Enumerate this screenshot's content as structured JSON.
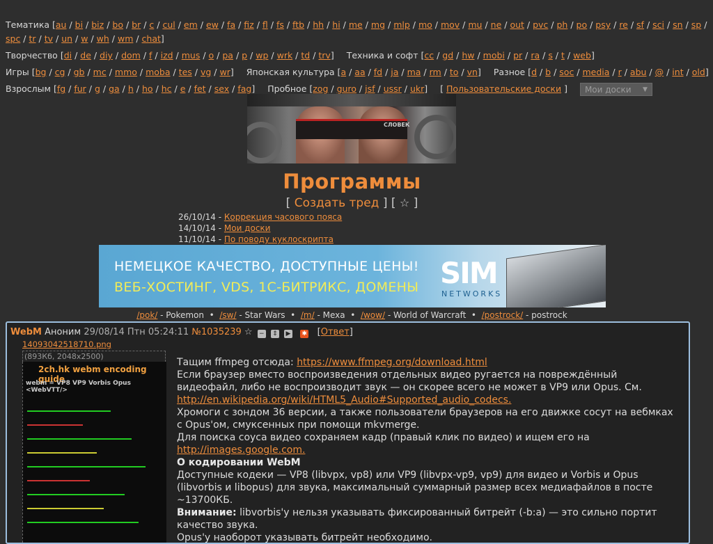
{
  "nav": {
    "row1_label": "Тематика",
    "row1": [
      "au",
      "bi",
      "biz",
      "bo",
      "br",
      "c",
      "cul",
      "em",
      "ew",
      "fa",
      "fiz",
      "fl",
      "fs",
      "ftb",
      "hh",
      "hi",
      "me",
      "mg",
      "mlp",
      "mo",
      "mov",
      "mu",
      "ne",
      "out",
      "pvc",
      "ph",
      "po",
      "psy",
      "re",
      "sf",
      "sci",
      "sn",
      "sp",
      "spc",
      "tr",
      "tv",
      "un",
      "w",
      "wh",
      "wm",
      "chat"
    ],
    "row2_label": "Творчество",
    "row2": [
      "di",
      "de",
      "diy",
      "dom",
      "f",
      "izd",
      "mus",
      "o",
      "pa",
      "p",
      "wp",
      "wrk",
      "td",
      "trv"
    ],
    "row2b_label": "Техника и софт",
    "row2b": [
      "cc",
      "gd",
      "hw",
      "mobi",
      "pr",
      "ra",
      "s",
      "t",
      "web"
    ],
    "row3_label": "Игры",
    "row3": [
      "bg",
      "cg",
      "gb",
      "mc",
      "mmo",
      "moba",
      "tes",
      "vg",
      "wr"
    ],
    "row3b_label": "Японская культура",
    "row3b": [
      "a",
      "aa",
      "fd",
      "ja",
      "ma",
      "rm",
      "to",
      "vn"
    ],
    "row3c_label": "Разное",
    "row3c": [
      "d",
      "b",
      "soc",
      "media",
      "r",
      "abu",
      "@",
      "int",
      "old"
    ],
    "row4_label": "Взрослым",
    "row4": [
      "fg",
      "fur",
      "g",
      "ga",
      "h",
      "ho",
      "hc",
      "e",
      "fet",
      "sex",
      "fag"
    ],
    "row4b_label": "Пробное",
    "row4b": [
      "zog",
      "guro",
      "jsf",
      "ussr",
      "ukr"
    ],
    "user_boards": "Пользовательские доски",
    "my_boards": "Мои доски"
  },
  "logo_text": "СЛОВЕК",
  "board_title": "Программы",
  "create_thread": "Создать тред",
  "news": [
    {
      "date": "26/10/14 -",
      "text": "Коррекция часового пояса"
    },
    {
      "date": "14/10/14 -",
      "text": "Мои доски"
    },
    {
      "date": "11/10/14 -",
      "text": "По поводу куклоскрипта"
    }
  ],
  "banner": {
    "line1": "НЕМЕЦКОЕ КАЧЕСТВО, ДОСТУПНЫЕ ЦЕНЫ!",
    "line2": "ВЕБ-ХОСТИНГ, VDS, 1С-БИТРИКС, ДОМЕНЫ",
    "brand": "SIM",
    "brand_sub": "NETWORKS"
  },
  "boards_line": [
    {
      "code": "/pok/",
      "name": "Pokemon"
    },
    {
      "code": "/sw/",
      "name": "Star Wars"
    },
    {
      "code": "/m/",
      "name": "Mexa"
    },
    {
      "code": "/wow/",
      "name": "World of Warcraft"
    },
    {
      "code": "/postrock/",
      "name": "postrock"
    }
  ],
  "post": {
    "subject": "WebM",
    "author": "Аноним",
    "date": "29/08/14 Птн 05:24:11",
    "number": "№1035239",
    "reply": "Ответ",
    "file_name": "14093042518710.png",
    "file_meta": "(893Кб, 2048x2500)",
    "thumb_title": "2ch.hk webm encoding guide",
    "thumb_sub": "webm = VP8 VP9 Vorbis Opus <WebVTT/>",
    "p1_pre": "Тащим ffmpeg отсюда: ",
    "p1_link": "https://www.ffmpeg.org/download.html",
    "p2": "Если браузер вместо воспроизведения отдельных видео ругается на повреждённый видеофайл, либо не воспроизводит звук — он скорее всего не может в VP9 или Opus. См. ",
    "p2_link": "http://en.wikipedia.org/wiki/HTML5_Audio#Supported_audio_codecs.",
    "p3": "Хромоги с зондом 36 версии, а также пользователи браузеров на его движке сосут на вебмках с Opus'ом, смуксенных при помощи mkvmerge.",
    "p4": "Для поиска соуса видео сохраняем кадр (правый клик по видео) и ищем его на ",
    "p4_link": "http://images.google.com.",
    "h1": "О кодировании WebM",
    "p5": "Доступные кодеки — VP8 (libvpx, vp8) или VP9 (libvpx-vp9, vp9) для видео и Vorbis и Opus (libvorbis и libopus) для звука, максимальный суммарный размер всех медиафайлов в посте ~13700КБ.",
    "warn_label": "Внимание:",
    "p6": " libvorbis'у нельзя указывать фиксированный битрейт (-b:a) — это сильно портит качество звука.",
    "p7": "Opus'у наоборот указывать битрейт необходимо."
  },
  "colors": {
    "accent": "#ee8d3c",
    "background": "#2e2e2e",
    "post_border": "#9cbede"
  }
}
